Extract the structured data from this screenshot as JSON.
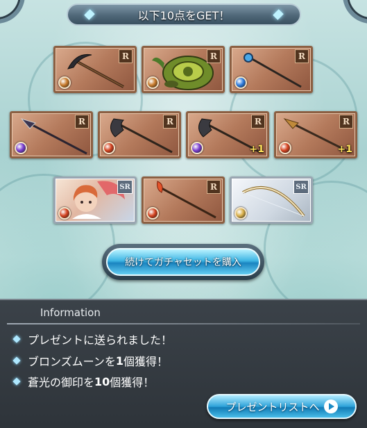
{
  "header": {
    "title": "以下10点をGET！"
  },
  "items": [
    {
      "name": "pickaxe-weapon",
      "rarity": "R",
      "element": "earth",
      "element_color": "#c77a2a",
      "plus": ""
    },
    {
      "name": "turtle-summon",
      "rarity": "R",
      "element": "earth",
      "element_color": "#c77a2a",
      "plus": ""
    },
    {
      "name": "staff-weapon",
      "rarity": "R",
      "element": "water",
      "element_color": "#2f7de0",
      "plus": ""
    },
    {
      "name": "spear-weapon",
      "rarity": "R",
      "element": "dark",
      "element_color": "#7a3fd1",
      "plus": ""
    },
    {
      "name": "axe-weapon",
      "rarity": "R",
      "element": "fire",
      "element_color": "#d4421f",
      "plus": ""
    },
    {
      "name": "axe-weapon",
      "rarity": "R",
      "element": "dark",
      "element_color": "#7a3fd1",
      "plus": "+1"
    },
    {
      "name": "spear-weapon",
      "rarity": "R",
      "element": "fire",
      "element_color": "#d4421f",
      "plus": "+1"
    },
    {
      "name": "character-summon",
      "rarity": "SR",
      "element": "fire",
      "element_color": "#d4421f",
      "plus": ""
    },
    {
      "name": "fire-staff-weapon",
      "rarity": "R",
      "element": "fire",
      "element_color": "#d4421f",
      "plus": ""
    },
    {
      "name": "bow-weapon",
      "rarity": "SR",
      "element": "light",
      "element_color": "#d9b04a",
      "plus": ""
    }
  ],
  "buy_button": {
    "label": "続けてガチャセットを購入"
  },
  "info": {
    "heading": "Information",
    "messages": [
      {
        "text": "プレゼントに送られました！"
      },
      {
        "prefix": "ブロンズムーンを",
        "count": "1",
        "suffix": "個獲得！"
      },
      {
        "prefix": "蒼光の御印を",
        "count": "10",
        "suffix": "個獲得！"
      }
    ]
  },
  "present_button": {
    "label": "プレゼントリストへ"
  }
}
